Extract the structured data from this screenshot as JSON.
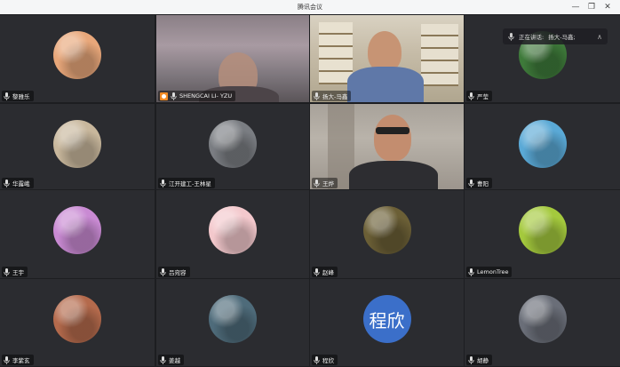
{
  "window": {
    "title": "腾讯会议",
    "minimize": "—",
    "maximize": "❐",
    "close": "✕"
  },
  "speaking": {
    "label": "正在讲话:",
    "name": "扬大-马鑫;",
    "toggle": "∧"
  },
  "participants": [
    {
      "name": "黎雅乐",
      "kind": "avatar",
      "avatar_color": "#e8a77a"
    },
    {
      "name": "SHENGCAI LI- YZU",
      "kind": "video",
      "host": true
    },
    {
      "name": "扬大-马鑫",
      "kind": "video"
    },
    {
      "name": "严莹",
      "kind": "avatar",
      "avatar_color": "#3e7a3a"
    },
    {
      "name": "华露峨",
      "kind": "avatar",
      "avatar_color": "#c8b79c"
    },
    {
      "name": "江开建工-王林星",
      "kind": "avatar",
      "avatar_color": "#7a7d82"
    },
    {
      "name": "王烨",
      "kind": "video"
    },
    {
      "name": "曹阳",
      "kind": "avatar",
      "avatar_color": "#5aa9d6"
    },
    {
      "name": "王宇",
      "kind": "avatar",
      "avatar_color": "#c98ad3"
    },
    {
      "name": "吕宛容",
      "kind": "avatar",
      "avatar_color": "#f3c8cc"
    },
    {
      "name": "赵峰",
      "kind": "avatar",
      "avatar_color": "#6b5f36"
    },
    {
      "name": "LemonTree",
      "kind": "avatar",
      "avatar_color": "#a4c93d"
    },
    {
      "name": "李紫玄",
      "kind": "avatar",
      "avatar_color": "#b46a4c"
    },
    {
      "name": "姜越",
      "kind": "avatar",
      "avatar_color": "#4e6b7a"
    },
    {
      "name": "程欣",
      "kind": "text",
      "avatar_text": "程欣",
      "avatar_color": "#3b6fc9"
    },
    {
      "name": "胡静",
      "kind": "avatar",
      "avatar_color": "#6a6e78"
    }
  ]
}
